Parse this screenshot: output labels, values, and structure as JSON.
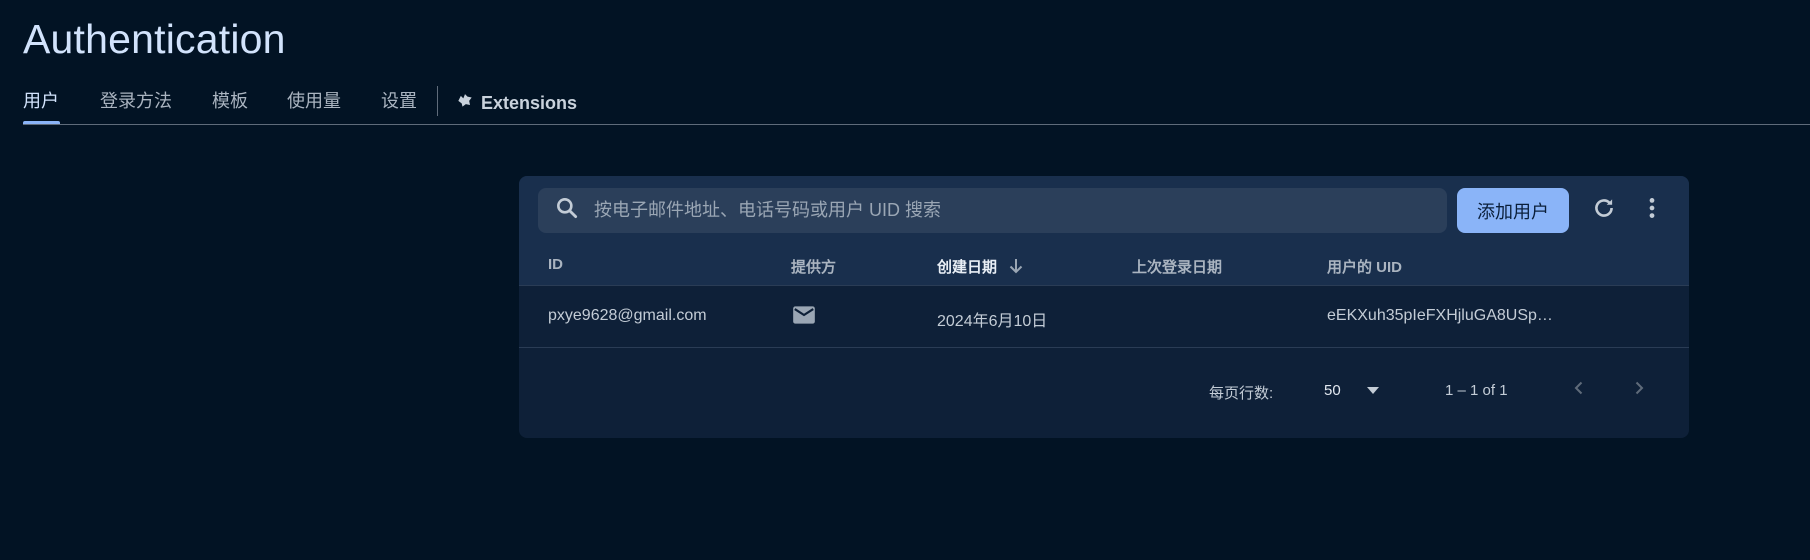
{
  "header": {
    "title": "Authentication"
  },
  "tabs": {
    "items": [
      {
        "label": "用户",
        "active": true
      },
      {
        "label": "登录方法"
      },
      {
        "label": "模板"
      },
      {
        "label": "使用量"
      },
      {
        "label": "设置"
      }
    ],
    "extensions_label": "Extensions",
    "extensions_icon": "extensions-icon"
  },
  "toolbar": {
    "search_placeholder": "按电子邮件地址、电话号码或用户 UID 搜索",
    "search_value": "",
    "search_icon": "search-icon",
    "add_user_label": "添加用户",
    "refresh_icon": "refresh-icon",
    "more_icon": "more-vert-icon"
  },
  "table": {
    "columns": [
      "ID",
      "提供方",
      "创建日期",
      "上次登录日期",
      "用户的 UID"
    ],
    "sorted_column": "创建日期",
    "sort_direction": "descending",
    "rows": [
      {
        "id": "pxye9628@gmail.com",
        "provider_icon": "email-icon",
        "created": "2024年6月10日",
        "last_sign_in": "",
        "uid": "eEKXuh35pIeFXHjluGA8USpY..."
      }
    ]
  },
  "pagination": {
    "rows_per_page_label": "每页行数:",
    "rows_per_page": "50",
    "range": "1 – 1 of 1",
    "prev_icon": "chevron-left-icon",
    "next_icon": "chevron-right-icon"
  },
  "colors": {
    "background": "#021324",
    "card": "#0e2038",
    "card_header": "#192f4d",
    "accent": "#8ab4f8"
  }
}
